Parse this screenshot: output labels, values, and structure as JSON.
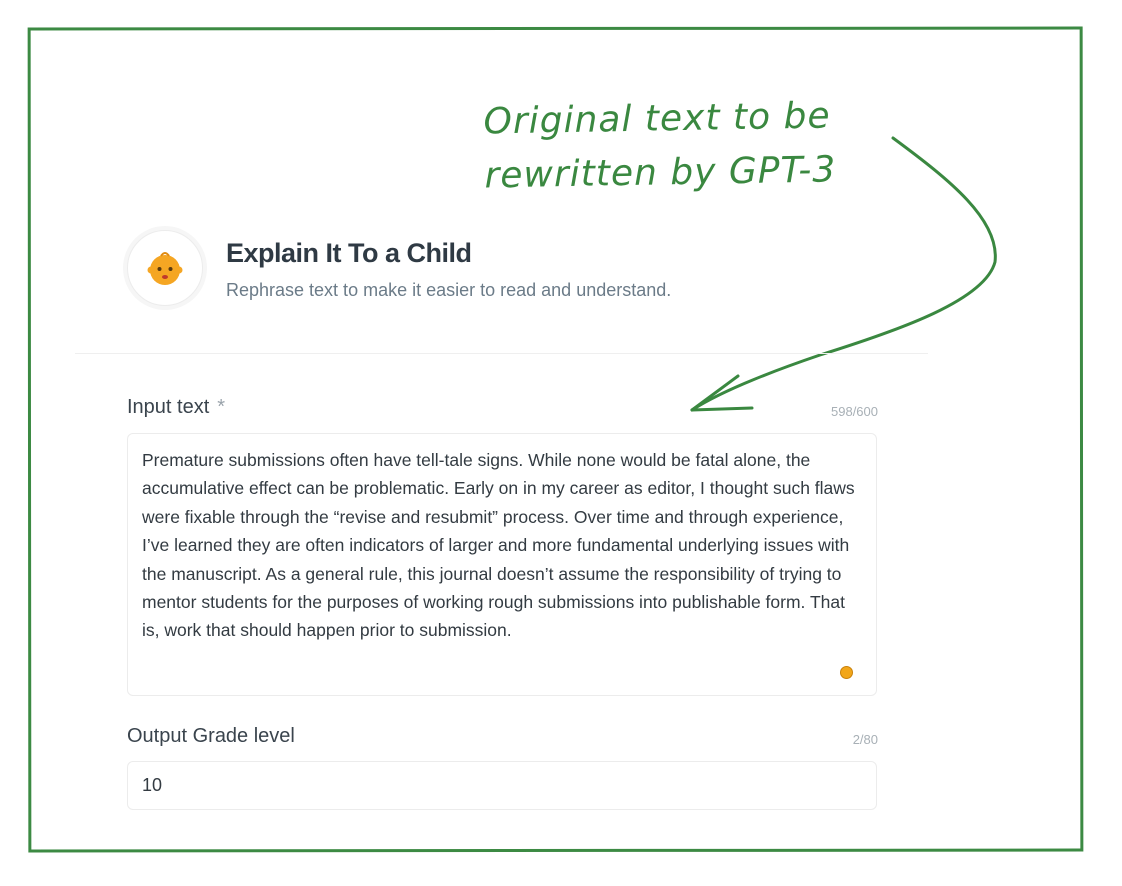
{
  "annotation": {
    "line1": "Original text to be",
    "line2": "rewritten by GPT-3"
  },
  "app": {
    "icon": "baby-face-icon",
    "title": "Explain It To a Child",
    "subtitle": "Rephrase text to make it easier to read and understand."
  },
  "input_text": {
    "label": "Input text",
    "required_mark": "*",
    "counter": "598/600",
    "value": "Premature submissions often have tell-tale signs. While none would be fatal alone, the accumulative effect can be problematic. Early on in my career as editor, I thought such flaws were fixable through the “revise and resubmit” process. Over time and through experience, I’ve learned they are often indicators of larger and more fundamental underlying issues with the manuscript. As a general rule, this journal doesn’t assume the responsibility of trying to mentor students for the purposes of working rough submissions into publishable form. That is, work that should happen prior to submission."
  },
  "grade_level": {
    "label": "Output Grade level",
    "counter": "2/80",
    "value": "10"
  },
  "colors": {
    "annotation_green": "#3a8840",
    "frame_green": "#3c8a43",
    "status_dot": "#f2a619"
  }
}
